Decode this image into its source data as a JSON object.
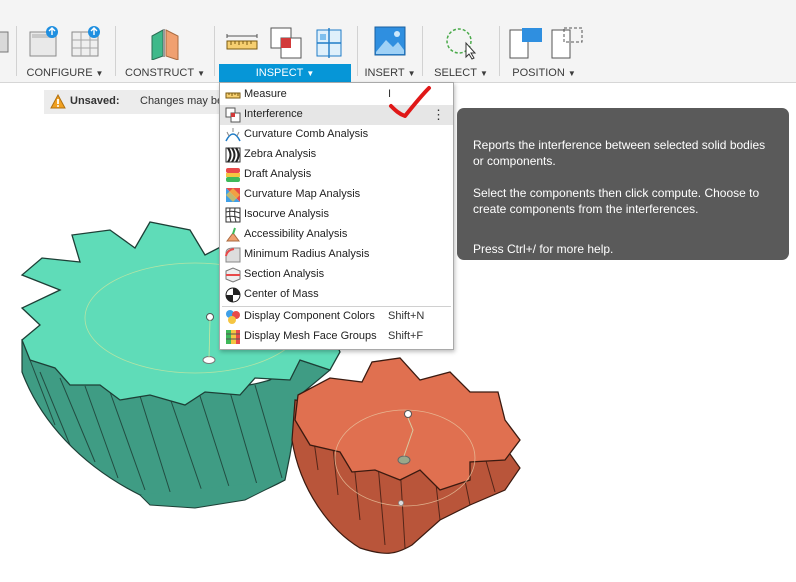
{
  "toolbar": {
    "groups": [
      {
        "label": "CONFIGURE"
      },
      {
        "label": "CONSTRUCT"
      },
      {
        "label": "INSPECT"
      },
      {
        "label": "INSERT"
      },
      {
        "label": "SELECT"
      },
      {
        "label": "POSITION"
      }
    ],
    "active_group": "INSPECT",
    "accent_color": "#0696d7"
  },
  "notification": {
    "title": "Unsaved:",
    "message": "Changes may be"
  },
  "inspect_menu": {
    "items": [
      {
        "label": "Measure",
        "shortcut": "I",
        "icon": "ruler-icon"
      },
      {
        "label": "Interference",
        "shortcut": "",
        "icon": "interference-icon",
        "highlighted": true
      },
      {
        "label": "Curvature Comb Analysis",
        "shortcut": "",
        "icon": "curvature-comb-icon"
      },
      {
        "label": "Zebra Analysis",
        "shortcut": "",
        "icon": "zebra-icon"
      },
      {
        "label": "Draft Analysis",
        "shortcut": "",
        "icon": "draft-icon"
      },
      {
        "label": "Curvature Map Analysis",
        "shortcut": "",
        "icon": "curvature-map-icon"
      },
      {
        "label": "Isocurve Analysis",
        "shortcut": "",
        "icon": "isocurve-icon"
      },
      {
        "label": "Accessibility Analysis",
        "shortcut": "",
        "icon": "accessibility-icon"
      },
      {
        "label": "Minimum Radius Analysis",
        "shortcut": "",
        "icon": "minimum-radius-icon"
      },
      {
        "label": "Section Analysis",
        "shortcut": "",
        "icon": "section-icon"
      },
      {
        "label": "Center of Mass",
        "shortcut": "",
        "icon": "center-of-mass-icon"
      },
      {
        "label": "Display Component Colors",
        "shortcut": "Shift+N",
        "icon": "component-colors-icon"
      },
      {
        "label": "Display Mesh Face Groups",
        "shortcut": "Shift+F",
        "icon": "mesh-face-groups-icon"
      }
    ],
    "more_glyph": "⋮"
  },
  "tooltip": {
    "line1": "Reports the interference between selected solid bodies or components.",
    "line2": "Select the components then click compute. Choose to create components from the interferences.",
    "line3": "Press Ctrl+/ for more help."
  },
  "colors": {
    "large_gear": "#5fdcb8",
    "large_gear_side": "#3f9c84",
    "small_gear": "#e07050",
    "small_gear_side": "#b9553a",
    "annotation_check": "#e01818",
    "tooltip_bg": "#5a5a5a"
  }
}
